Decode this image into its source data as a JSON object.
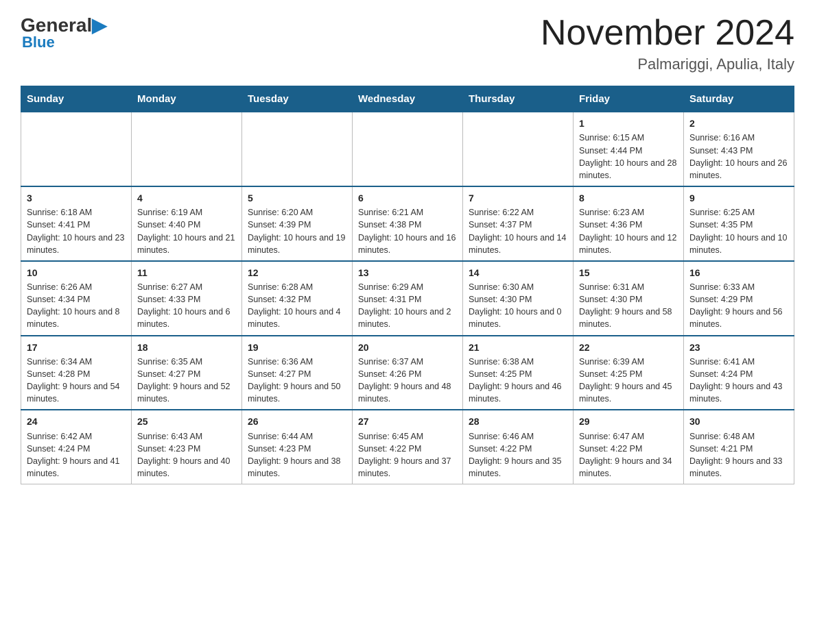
{
  "header": {
    "logo_general": "General",
    "logo_blue": "Blue",
    "main_title": "November 2024",
    "subtitle": "Palmariggi, Apulia, Italy"
  },
  "days_of_week": [
    "Sunday",
    "Monday",
    "Tuesday",
    "Wednesday",
    "Thursday",
    "Friday",
    "Saturday"
  ],
  "weeks": [
    {
      "days": [
        {
          "number": "",
          "info": ""
        },
        {
          "number": "",
          "info": ""
        },
        {
          "number": "",
          "info": ""
        },
        {
          "number": "",
          "info": ""
        },
        {
          "number": "",
          "info": ""
        },
        {
          "number": "1",
          "info": "Sunrise: 6:15 AM\nSunset: 4:44 PM\nDaylight: 10 hours and 28 minutes."
        },
        {
          "number": "2",
          "info": "Sunrise: 6:16 AM\nSunset: 4:43 PM\nDaylight: 10 hours and 26 minutes."
        }
      ]
    },
    {
      "days": [
        {
          "number": "3",
          "info": "Sunrise: 6:18 AM\nSunset: 4:41 PM\nDaylight: 10 hours and 23 minutes."
        },
        {
          "number": "4",
          "info": "Sunrise: 6:19 AM\nSunset: 4:40 PM\nDaylight: 10 hours and 21 minutes."
        },
        {
          "number": "5",
          "info": "Sunrise: 6:20 AM\nSunset: 4:39 PM\nDaylight: 10 hours and 19 minutes."
        },
        {
          "number": "6",
          "info": "Sunrise: 6:21 AM\nSunset: 4:38 PM\nDaylight: 10 hours and 16 minutes."
        },
        {
          "number": "7",
          "info": "Sunrise: 6:22 AM\nSunset: 4:37 PM\nDaylight: 10 hours and 14 minutes."
        },
        {
          "number": "8",
          "info": "Sunrise: 6:23 AM\nSunset: 4:36 PM\nDaylight: 10 hours and 12 minutes."
        },
        {
          "number": "9",
          "info": "Sunrise: 6:25 AM\nSunset: 4:35 PM\nDaylight: 10 hours and 10 minutes."
        }
      ]
    },
    {
      "days": [
        {
          "number": "10",
          "info": "Sunrise: 6:26 AM\nSunset: 4:34 PM\nDaylight: 10 hours and 8 minutes."
        },
        {
          "number": "11",
          "info": "Sunrise: 6:27 AM\nSunset: 4:33 PM\nDaylight: 10 hours and 6 minutes."
        },
        {
          "number": "12",
          "info": "Sunrise: 6:28 AM\nSunset: 4:32 PM\nDaylight: 10 hours and 4 minutes."
        },
        {
          "number": "13",
          "info": "Sunrise: 6:29 AM\nSunset: 4:31 PM\nDaylight: 10 hours and 2 minutes."
        },
        {
          "number": "14",
          "info": "Sunrise: 6:30 AM\nSunset: 4:30 PM\nDaylight: 10 hours and 0 minutes."
        },
        {
          "number": "15",
          "info": "Sunrise: 6:31 AM\nSunset: 4:30 PM\nDaylight: 9 hours and 58 minutes."
        },
        {
          "number": "16",
          "info": "Sunrise: 6:33 AM\nSunset: 4:29 PM\nDaylight: 9 hours and 56 minutes."
        }
      ]
    },
    {
      "days": [
        {
          "number": "17",
          "info": "Sunrise: 6:34 AM\nSunset: 4:28 PM\nDaylight: 9 hours and 54 minutes."
        },
        {
          "number": "18",
          "info": "Sunrise: 6:35 AM\nSunset: 4:27 PM\nDaylight: 9 hours and 52 minutes."
        },
        {
          "number": "19",
          "info": "Sunrise: 6:36 AM\nSunset: 4:27 PM\nDaylight: 9 hours and 50 minutes."
        },
        {
          "number": "20",
          "info": "Sunrise: 6:37 AM\nSunset: 4:26 PM\nDaylight: 9 hours and 48 minutes."
        },
        {
          "number": "21",
          "info": "Sunrise: 6:38 AM\nSunset: 4:25 PM\nDaylight: 9 hours and 46 minutes."
        },
        {
          "number": "22",
          "info": "Sunrise: 6:39 AM\nSunset: 4:25 PM\nDaylight: 9 hours and 45 minutes."
        },
        {
          "number": "23",
          "info": "Sunrise: 6:41 AM\nSunset: 4:24 PM\nDaylight: 9 hours and 43 minutes."
        }
      ]
    },
    {
      "days": [
        {
          "number": "24",
          "info": "Sunrise: 6:42 AM\nSunset: 4:24 PM\nDaylight: 9 hours and 41 minutes."
        },
        {
          "number": "25",
          "info": "Sunrise: 6:43 AM\nSunset: 4:23 PM\nDaylight: 9 hours and 40 minutes."
        },
        {
          "number": "26",
          "info": "Sunrise: 6:44 AM\nSunset: 4:23 PM\nDaylight: 9 hours and 38 minutes."
        },
        {
          "number": "27",
          "info": "Sunrise: 6:45 AM\nSunset: 4:22 PM\nDaylight: 9 hours and 37 minutes."
        },
        {
          "number": "28",
          "info": "Sunrise: 6:46 AM\nSunset: 4:22 PM\nDaylight: 9 hours and 35 minutes."
        },
        {
          "number": "29",
          "info": "Sunrise: 6:47 AM\nSunset: 4:22 PM\nDaylight: 9 hours and 34 minutes."
        },
        {
          "number": "30",
          "info": "Sunrise: 6:48 AM\nSunset: 4:21 PM\nDaylight: 9 hours and 33 minutes."
        }
      ]
    }
  ]
}
